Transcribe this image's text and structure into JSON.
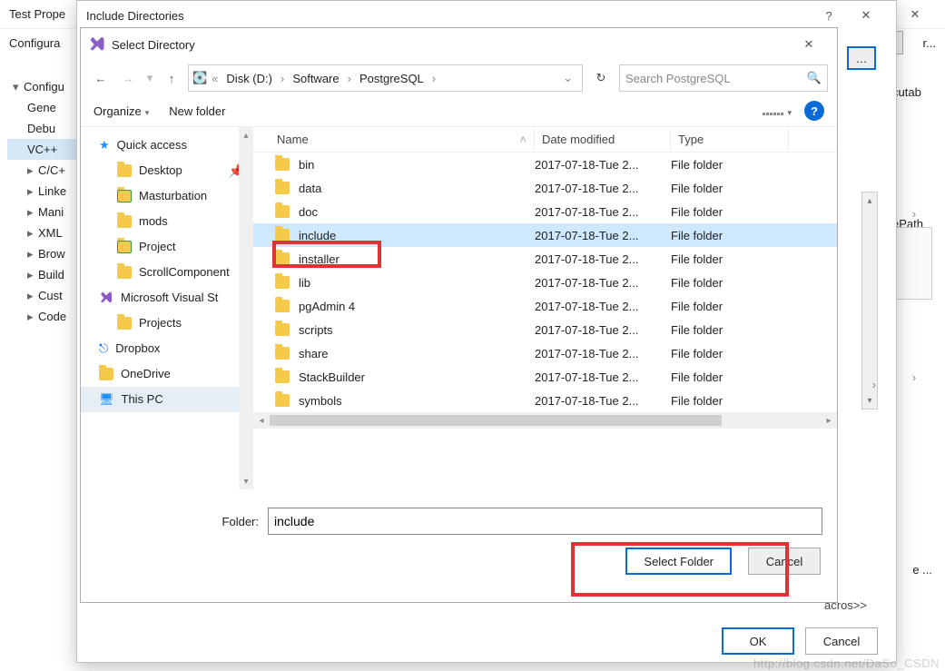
{
  "bg1": {
    "title": "Test Prope",
    "config_label": "Configura",
    "tree": [
      "Configu",
      "Gene",
      "Debu",
      "VC++",
      "C/C+",
      "Linke",
      "Mani",
      "XML",
      "Brow",
      "Build",
      "Cust",
      "Code"
    ],
    "right_labels": [
      "cutab",
      "ePath",
      "e ..."
    ],
    "footer": {
      "ok": "OK",
      "cancel": "Cancel"
    }
  },
  "bg2": {
    "title": "Include Directories",
    "expand": "acros>>",
    "ok": "OK",
    "cancel": "Cancel"
  },
  "fp": {
    "title": "Select Directory",
    "breadcrumbs": [
      "Disk (D:)",
      "Software",
      "PostgreSQL"
    ],
    "search_placeholder": "Search PostgreSQL",
    "toolbar": {
      "organize": "Organize",
      "newfolder": "New folder"
    },
    "columns": {
      "name": "Name",
      "date": "Date modified",
      "type": "Type"
    },
    "nav": [
      {
        "label": "Quick access",
        "kind": "qa"
      },
      {
        "label": "Desktop",
        "kind": "folder",
        "sub": true,
        "pin": true
      },
      {
        "label": "Masturbation",
        "kind": "folder-g",
        "sub": true
      },
      {
        "label": "mods",
        "kind": "folder",
        "sub": true
      },
      {
        "label": "Project",
        "kind": "folder-g",
        "sub": true
      },
      {
        "label": "ScrollComponent",
        "kind": "folder",
        "sub": true
      },
      {
        "label": "Microsoft Visual St",
        "kind": "vs"
      },
      {
        "label": "Projects",
        "kind": "folder",
        "sub": true
      },
      {
        "label": "Dropbox",
        "kind": "db"
      },
      {
        "label": "OneDrive",
        "kind": "folder"
      },
      {
        "label": "This PC",
        "kind": "pc",
        "sel": true
      }
    ],
    "rows": [
      {
        "name": "bin",
        "date": "2017-07-18-Tue 2...",
        "type": "File folder"
      },
      {
        "name": "data",
        "date": "2017-07-18-Tue 2...",
        "type": "File folder"
      },
      {
        "name": "doc",
        "date": "2017-07-18-Tue 2...",
        "type": "File folder"
      },
      {
        "name": "include",
        "date": "2017-07-18-Tue 2...",
        "type": "File folder",
        "sel": true,
        "hl": true
      },
      {
        "name": "installer",
        "date": "2017-07-18-Tue 2...",
        "type": "File folder"
      },
      {
        "name": "lib",
        "date": "2017-07-18-Tue 2...",
        "type": "File folder"
      },
      {
        "name": "pgAdmin 4",
        "date": "2017-07-18-Tue 2...",
        "type": "File folder"
      },
      {
        "name": "scripts",
        "date": "2017-07-18-Tue 2...",
        "type": "File folder"
      },
      {
        "name": "share",
        "date": "2017-07-18-Tue 2...",
        "type": "File folder"
      },
      {
        "name": "StackBuilder",
        "date": "2017-07-18-Tue 2...",
        "type": "File folder"
      },
      {
        "name": "symbols",
        "date": "2017-07-18-Tue 2...",
        "type": "File folder"
      }
    ],
    "folder_label": "Folder:",
    "folder_value": "include",
    "select": "Select Folder",
    "cancel": "Cancel"
  },
  "watermark": "http://blog.csdn.net/DaSo_CSDN"
}
